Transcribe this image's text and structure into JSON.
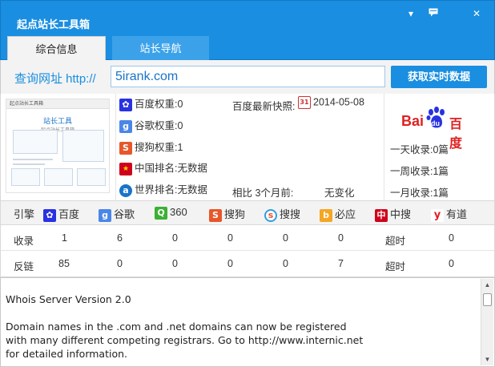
{
  "app": {
    "title": "起点站长工具箱"
  },
  "window": {
    "menu_glyph": "▾",
    "chat_glyph": "▭",
    "close_glyph": "✕"
  },
  "tabs": [
    {
      "label": "综合信息",
      "active": true
    },
    {
      "label": "站长导航",
      "active": false
    }
  ],
  "query": {
    "label": "查询网址 http://",
    "value": "5irank.com",
    "button": "获取实时数据"
  },
  "thumbnail": {
    "header": "起点站长工具箱",
    "title": "站长工具",
    "subtitle": "起点站长工具箱"
  },
  "ranks": {
    "baidu": "百度权重:0",
    "google": "谷歌权重:0",
    "sogou": "搜狗权重:1",
    "china": "中国排名:无数据",
    "world": "世界排名:无数据",
    "snapshot_label": "百度最新快照:",
    "snapshot_date": "2014-05-08",
    "compare_label": "相比 3个月前:",
    "compare_value": "无变化"
  },
  "baidu_logo": {
    "bai": "Bai",
    "du": "du",
    "cn": "百度"
  },
  "index_counts": {
    "day": "一天收录:0篇",
    "week": "一周收录:1篇",
    "month": "一月收录:1篇"
  },
  "engines": {
    "header": "引擎",
    "items": [
      {
        "name": "百度",
        "icon": "baidu-paw-icon",
        "color": "#2932e1"
      },
      {
        "name": "谷歌",
        "icon": "google-g-icon",
        "color": "#4a86e8"
      },
      {
        "name": "360",
        "icon": "360-search-icon",
        "color": "#3cb034"
      },
      {
        "name": "搜狗",
        "icon": "sogou-s-icon",
        "color": "#e8562a"
      },
      {
        "name": "搜搜",
        "icon": "soso-icon",
        "color": "#2f9fe0"
      },
      {
        "name": "必应",
        "icon": "bing-icon",
        "color": "#f5a623"
      },
      {
        "name": "中搜",
        "icon": "zhongsou-icon",
        "color": "#d0021b"
      },
      {
        "name": "有道",
        "icon": "youdao-icon",
        "color": "#e02020"
      }
    ]
  },
  "stats": {
    "indexed": {
      "label": "收录",
      "values": [
        "1",
        "6",
        "0",
        "0",
        "0",
        "0",
        "超时",
        "0"
      ]
    },
    "backlinks": {
      "label": "反链",
      "values": [
        "85",
        "0",
        "0",
        "0",
        "0",
        "7",
        "超时",
        "0"
      ]
    }
  },
  "whois": {
    "lines": [
      "Whois Server Version 2.0",
      "",
      "Domain names in the .com and .net domains can now be registered",
      "with many different competing registrars. Go to http://www.internic.net",
      "for detailed information."
    ]
  },
  "colors": {
    "accent": "#1a8ee0",
    "link": "#1a73c8"
  }
}
